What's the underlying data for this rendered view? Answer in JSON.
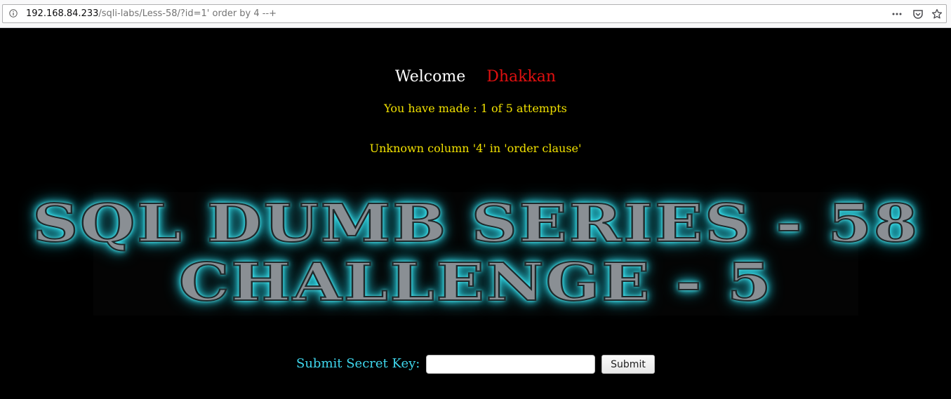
{
  "browser": {
    "url_host": "192.168.84.233",
    "url_path": "/sqli-labs/Less-58/?id=1' order by 4 --+"
  },
  "page": {
    "welcome_word": "Welcome",
    "welcome_name": "Dhakkan",
    "attempts_text": "You have made : 1 of 5 attempts",
    "error_text": "Unknown column '4' in 'order clause'",
    "banner_line1": "SQL DUMB SERIES - 58",
    "banner_line2": "CHALLENGE - 5",
    "submit_label": "Submit Secret Key:",
    "secret_input_value": "",
    "submit_button_label": "Submit"
  },
  "colors": {
    "background": "#000000",
    "welcome_name": "#e01010",
    "status_text": "#f0e000",
    "submit_label": "#3fd8ee",
    "banner_glow": "#3ee8f5"
  },
  "icons": {
    "url_info": "info-icon",
    "page_actions": "more-horizontal-icon",
    "pocket": "pocket-icon",
    "bookmark": "star-icon"
  }
}
